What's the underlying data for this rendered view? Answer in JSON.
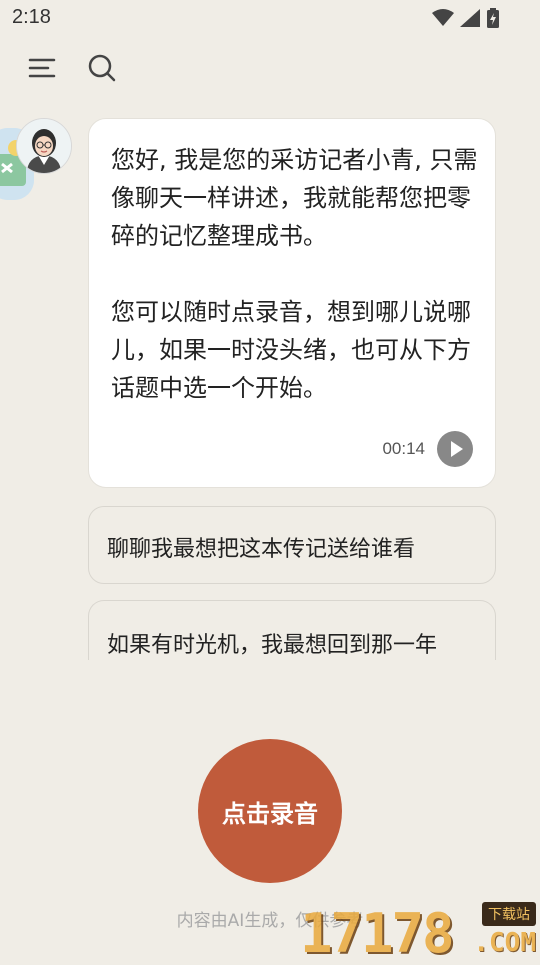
{
  "status_bar": {
    "time": "2:18"
  },
  "toolbar": {
    "menu_icon": "menu-icon",
    "search_icon": "search-icon"
  },
  "chat": {
    "message_paragraphs": [
      "您好, 我是您的采访记者小青, 只需像聊天一样讲述，我就能帮您把零碎的记忆整理成书。",
      "您可以随时点录音，想到哪儿说哪儿，如果一时没头绪，也可从下方话题中选一个开始。"
    ],
    "audio_duration": "00:14"
  },
  "suggestions": [
    "聊聊我最想把这本传记送给谁看",
    "如果有时光机，我最想回到那一年"
  ],
  "record_button_label": "点击录音",
  "disclaimer": "内容由AI生成，仅供参考",
  "watermark": {
    "number": "17178",
    "tag": "下载站",
    "domain": ".COM"
  },
  "colors": {
    "background": "#f0ede6",
    "accent": "#c05b3b",
    "bubble": "#ffffff"
  }
}
